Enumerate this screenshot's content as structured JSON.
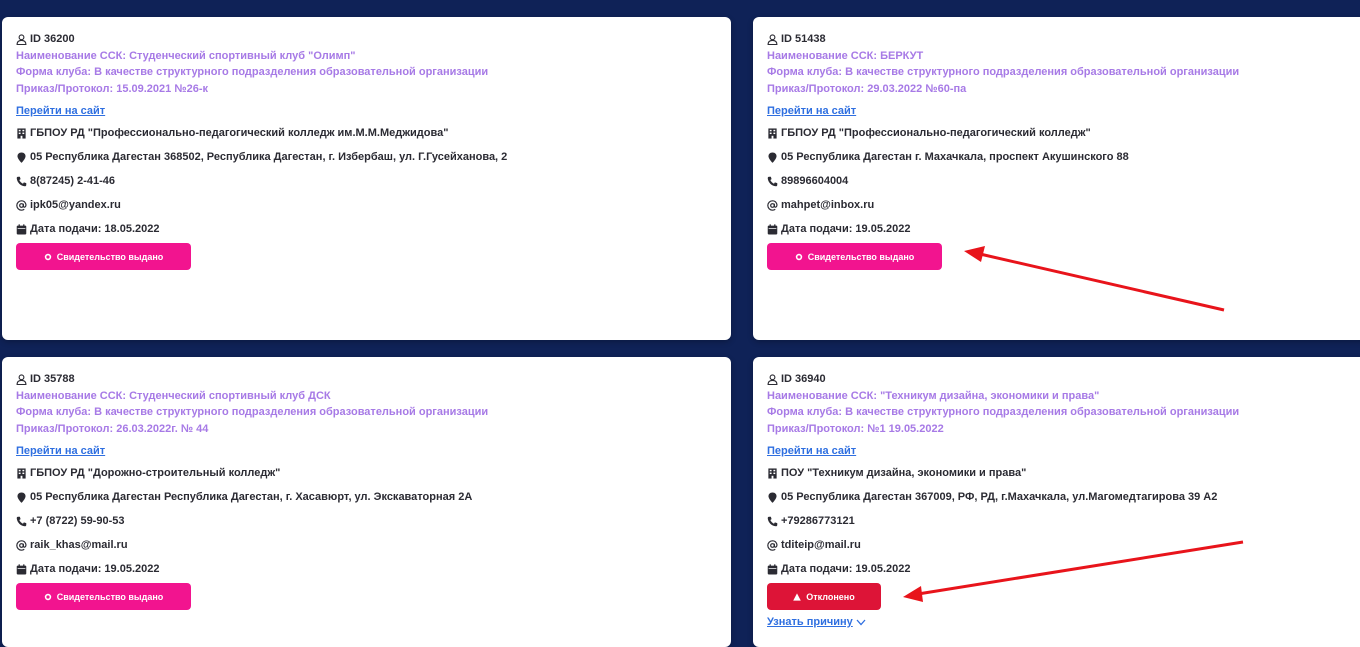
{
  "cards": [
    {
      "id": "ID 36200",
      "name": "Наименование ССК: Студенческий спортивный клуб \"Олимп\"",
      "form": "Форма клуба: В качестве структурного подразделения образовательной организации",
      "order": "Приказ/Протокол: 15.09.2021 №26-к",
      "link": "Перейти на сайт",
      "org": "ГБПОУ РД \"Профессионально-педагогический колледж им.М.М.Меджидова\"",
      "address": "05 Республика Дагестан 368502, Республика Дагестан, г. Избербаш, ул. Г.Гусейханова, 2",
      "phone": "8(87245) 2-41-46",
      "email": "ipk05@yandex.ru",
      "date": "Дата подачи: 18.05.2022",
      "status": "Свидетельство выдано"
    },
    {
      "id": "ID 51438",
      "name": "Наименование ССК: БЕРКУТ",
      "form": "Форма клуба: В качестве структурного подразделения образовательной организации",
      "order": "Приказ/Протокол: 29.03.2022 №60-па",
      "link": "Перейти на сайт",
      "org": "ГБПОУ РД \"Профессионально-педагогический колледж\"",
      "address": "05 Республика Дагестан г. Махачкала, проспект Акушинского 88",
      "phone": "89896604004",
      "email": "mahpet@inbox.ru",
      "date": "Дата подачи: 19.05.2022",
      "status": "Свидетельство выдано"
    },
    {
      "id": "ID 35788",
      "name": "Наименование ССК: Студенческий спортивный клуб ДСК",
      "form": "Форма клуба: В качестве структурного подразделения образовательной организации",
      "order": "Приказ/Протокол: 26.03.2022г. № 44",
      "link": "Перейти на сайт",
      "org": "ГБПОУ РД \"Дорожно-строительный колледж\"",
      "address": "05 Республика Дагестан Республика Дагестан, г. Хасавюрт, ул. Экскаваторная 2А",
      "phone": "+7 (8722) 59-90-53",
      "email": "raik_khas@mail.ru",
      "date": "Дата подачи: 19.05.2022",
      "status": "Свидетельство выдано"
    },
    {
      "id": "ID 36940",
      "name": "Наименование ССК: \"Техникум дизайна, экономики и права\"",
      "form": "Форма клуба: В качестве структурного подразделения образовательной организации",
      "order": "Приказ/Протокол: №1 19.05.2022",
      "link": "Перейти на сайт",
      "org": "ПОУ \"Техникум дизайна, экономики и права\"",
      "address": "05 Республика Дагестан 367009, РФ, РД, г.Махачкала, ул.Магомедтагирова 39 А2",
      "phone": "+79286773121",
      "email": "tditeip@mail.ru",
      "date": "Дата подачи: 19.05.2022",
      "status": "Отклонено",
      "reason_link": "Узнать причину"
    }
  ],
  "icons": {
    "id": "user-icon",
    "org": "building-icon",
    "address": "map-marker-icon",
    "phone": "phone-icon",
    "email": "at-icon",
    "date": "calendar-icon",
    "approved": "certificate-icon",
    "rejected": "warning-icon"
  },
  "colors": {
    "background": "#0f2257",
    "accent_purple": "#a77ae6",
    "link_blue": "#2f6fe0",
    "approved_pink": "#f2148f",
    "rejected_red": "#dd1437",
    "annotation_arrow": "#e8141b"
  }
}
